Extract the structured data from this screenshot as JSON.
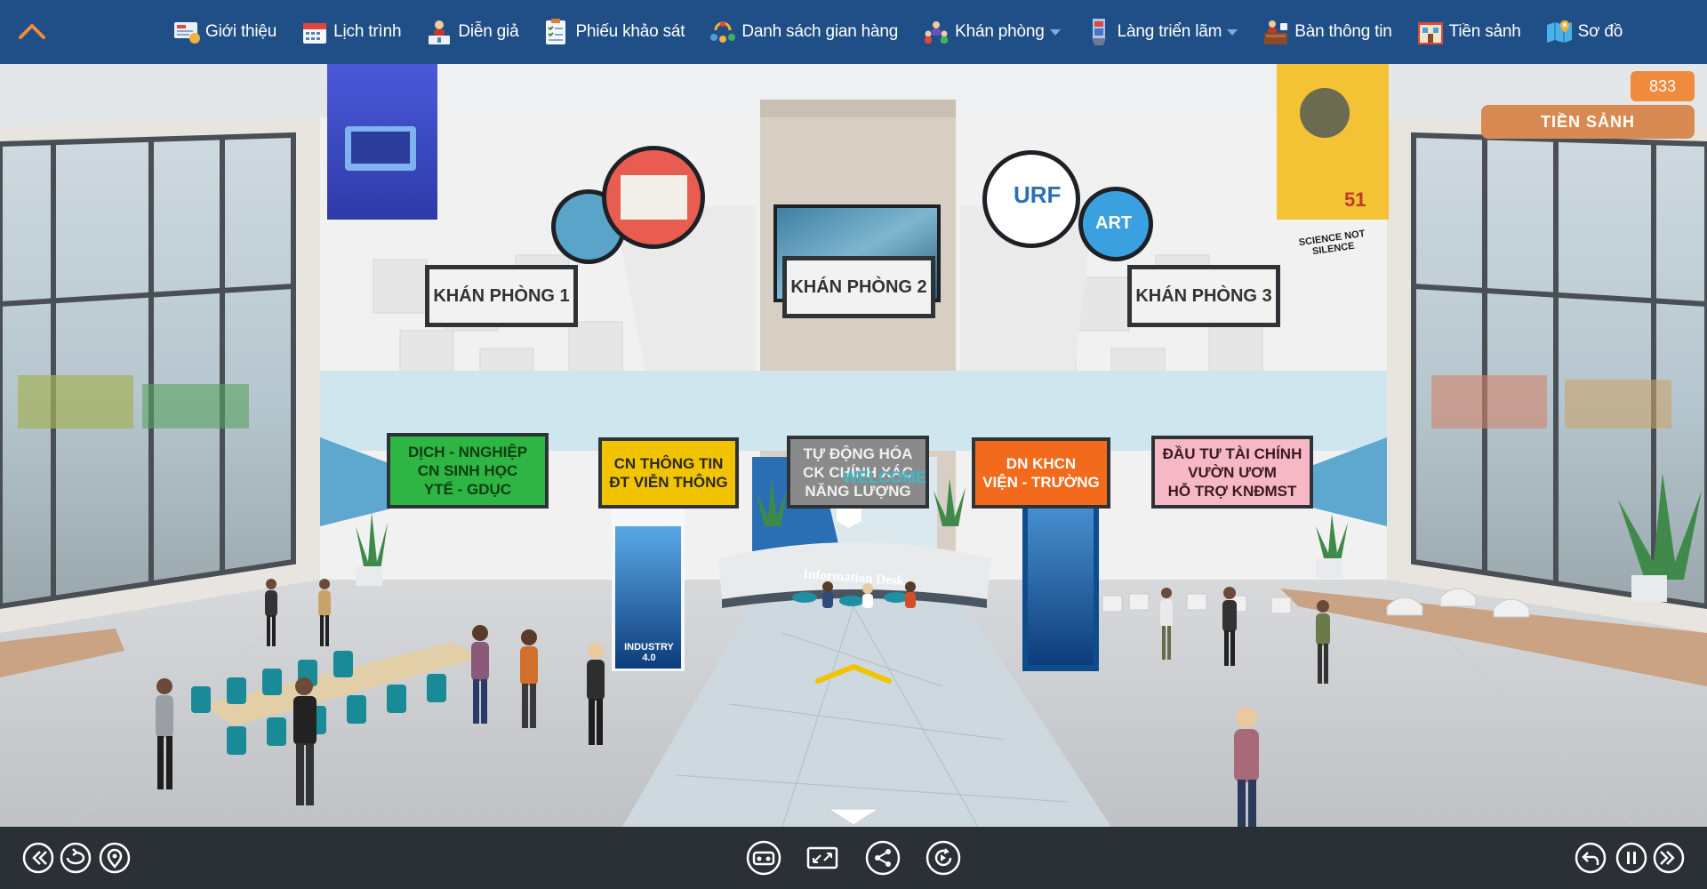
{
  "nav": {
    "items": [
      {
        "label": "Giới thiệu",
        "icon": "intro-icon",
        "dropdown": false
      },
      {
        "label": "Lịch trình",
        "icon": "calendar-icon",
        "dropdown": false
      },
      {
        "label": "Diễn giả",
        "icon": "speaker-icon",
        "dropdown": false
      },
      {
        "label": "Phiếu khảo sát",
        "icon": "survey-icon",
        "dropdown": false
      },
      {
        "label": "Danh sách gian hàng",
        "icon": "booth-list-icon",
        "dropdown": false
      },
      {
        "label": "Khán phòng",
        "icon": "auditorium-icon",
        "dropdown": true
      },
      {
        "label": "Làng triển lãm",
        "icon": "exhibition-icon",
        "dropdown": true
      },
      {
        "label": "Bàn thông tin",
        "icon": "info-desk-icon",
        "dropdown": false
      },
      {
        "label": "Tiền sảnh",
        "icon": "lobby-icon",
        "dropdown": false
      },
      {
        "label": "Sơ đồ",
        "icon": "map-icon",
        "dropdown": false
      }
    ]
  },
  "status": {
    "visitor_count": "833",
    "location": "TIỀN SẢNH"
  },
  "scene": {
    "hall_signs": [
      "KHÁN PHÒNG 1",
      "KHÁN PHÒNG 2",
      "KHÁN PHÒNG 3"
    ],
    "zone_signs": [
      {
        "lines": [
          "DỊCH - NNGHIỆP",
          "CN SINH HỌC",
          "YTẾ - GDỤC"
        ],
        "bg": "#2fb543",
        "fg": "#0b3f12"
      },
      {
        "lines": [
          "CN THÔNG TIN",
          "ĐT VIỄN THÔNG"
        ],
        "bg": "#f2c400",
        "fg": "#2a2a2a"
      },
      {
        "lines": [
          "TỰ ĐỘNG HÓA",
          "CK CHÍNH XÁC",
          "NĂNG LƯỢNG"
        ],
        "bg": "#8a8a8a",
        "fg": "#f0f0f0"
      },
      {
        "lines": [
          "DN KHCN",
          "VIỆN - TRƯỜNG"
        ],
        "bg": "#f26a1b",
        "fg": "#ffffff"
      },
      {
        "lines": [
          "ĐẦU TƯ TÀI CHÍNH",
          "VƯỜN ƯƠM",
          "HỖ TRỢ KNĐMST"
        ],
        "bg": "#f7b8c6",
        "fg": "#3a1a20"
      }
    ],
    "welcome": "WELCOME",
    "desk_label": "Information Desk",
    "banner_industry": "INDUSTRY 4.0",
    "poster_text": "SCIENCE NOT SILENCE",
    "poster_number": "51",
    "logo_text": "URF",
    "round_art_text": "ART"
  },
  "colors": {
    "nav_bg": "#1f4f86",
    "accent": "#f08a3c",
    "bottom_bg": "#2b2f36"
  },
  "controls": {
    "left": [
      {
        "name": "rewind-button",
        "icon": "rewind-icon"
      },
      {
        "name": "rotate-view-button",
        "icon": "rotate-icon"
      },
      {
        "name": "location-button",
        "icon": "location-pin-icon"
      }
    ],
    "center": [
      {
        "name": "vr-mode-button",
        "icon": "vr-headset-icon"
      },
      {
        "name": "fullscreen-button",
        "icon": "fullscreen-icon"
      },
      {
        "name": "share-button",
        "icon": "share-icon"
      },
      {
        "name": "autorotate-button",
        "icon": "autorotate-icon"
      }
    ],
    "right": [
      {
        "name": "back-button",
        "icon": "back-arrow-icon"
      },
      {
        "name": "pause-button",
        "icon": "pause-icon"
      },
      {
        "name": "forward-button",
        "icon": "fast-forward-icon"
      }
    ]
  }
}
